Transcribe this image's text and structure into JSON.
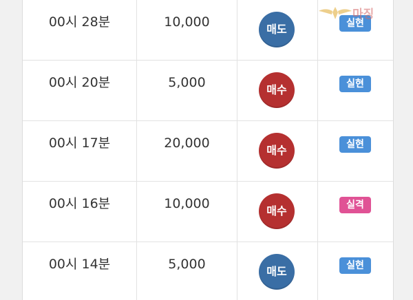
{
  "colors": {
    "sell": "#3a6ea5",
    "buy": "#b53030",
    "hit": "#4a90d9",
    "miss": "#e05295"
  },
  "logo_text": "마징",
  "rows": [
    {
      "time": "00시 28분",
      "amount": "10,000",
      "side": "매도",
      "side_type": "sell",
      "result": "실현",
      "result_type": "hit"
    },
    {
      "time": "00시 20분",
      "amount": "5,000",
      "side": "매수",
      "side_type": "buy",
      "result": "실현",
      "result_type": "hit"
    },
    {
      "time": "00시 17분",
      "amount": "20,000",
      "side": "매수",
      "side_type": "buy",
      "result": "실현",
      "result_type": "hit"
    },
    {
      "time": "00시 16분",
      "amount": "10,000",
      "side": "매수",
      "side_type": "buy",
      "result": "실격",
      "result_type": "miss"
    },
    {
      "time": "00시 14분",
      "amount": "5,000",
      "side": "매도",
      "side_type": "sell",
      "result": "실현",
      "result_type": "hit"
    }
  ]
}
